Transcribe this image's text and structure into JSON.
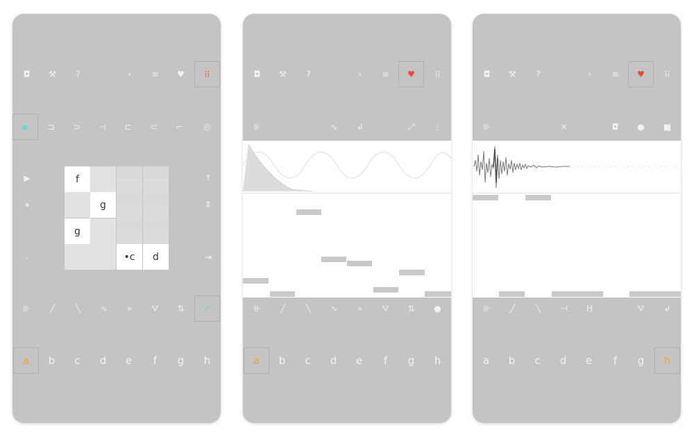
{
  "colors": {
    "phone_bg": "#c4c4c4",
    "icon": "#f2f2f2",
    "accent_orange": "#f0a040",
    "accent_cyan": "#5fd6e8",
    "accent_red": "#e24a3a",
    "note": "#c9c9c9"
  },
  "phones": [
    {
      "top_toolbar": [
        {
          "icon": "square-icon",
          "glyph": "◘",
          "selected": false
        },
        {
          "icon": "wrench-icon",
          "glyph": "⚒",
          "selected": false
        },
        {
          "icon": "help-icon",
          "glyph": "?",
          "selected": false
        },
        {
          "icon": "chevron-right-icon",
          "glyph": "›",
          "selected": false
        },
        {
          "icon": "menu-icon",
          "glyph": "≡",
          "selected": false
        },
        {
          "icon": "heart-icon",
          "glyph": "♥",
          "selected": false
        },
        {
          "icon": "grid-icon",
          "glyph": "⁞⁞",
          "selected": true,
          "accent": "red"
        }
      ],
      "second_toolbar": [
        {
          "icon": "pattern-icon-1",
          "glyph": "▪",
          "selected": true,
          "accent": "cyan"
        },
        {
          "icon": "pattern-icon-2",
          "glyph": "⊐",
          "selected": false
        },
        {
          "icon": "pattern-icon-3",
          "glyph": "⊃",
          "selected": false
        },
        {
          "icon": "pattern-icon-4",
          "glyph": "⊣",
          "selected": false
        },
        {
          "icon": "pattern-icon-5",
          "glyph": "⊏",
          "selected": false
        },
        {
          "icon": "pattern-icon-6",
          "glyph": "⊂",
          "selected": false
        },
        {
          "icon": "pattern-icon-7",
          "glyph": "⌐",
          "selected": false
        },
        {
          "icon": "pattern-icon-8",
          "glyph": "◎",
          "selected": false
        }
      ],
      "grid_labels": [
        "f",
        "g",
        "g",
        "•c",
        "d"
      ],
      "tools": [
        "⊪",
        "╱",
        "╲",
        "∿",
        "»",
        "⛛",
        "⇅",
        "✓"
      ],
      "letters": [
        "a",
        "b",
        "c",
        "d",
        "e",
        "f",
        "g",
        "h"
      ],
      "selected_letter": 0
    },
    {
      "top_toolbar": [
        {
          "icon": "square-icon",
          "glyph": "◘",
          "selected": false
        },
        {
          "icon": "wrench-icon",
          "glyph": "⚒",
          "selected": false
        },
        {
          "icon": "help-icon",
          "glyph": "?",
          "selected": false
        },
        {
          "icon": "chevron-right-icon",
          "glyph": "›",
          "selected": false
        },
        {
          "icon": "menu-icon",
          "glyph": "≡",
          "selected": false
        },
        {
          "icon": "heart-icon",
          "glyph": "♥",
          "selected": true,
          "accent": "red"
        },
        {
          "icon": "grid-icon",
          "glyph": "⁞⁞",
          "selected": false
        }
      ],
      "second_toolbar": [
        "⊪",
        "∿",
        "↲",
        "⤢",
        "⋮"
      ],
      "tools": [
        "⊪",
        "╱",
        "╲",
        "∿",
        "»",
        "⛛",
        "⇅",
        "●"
      ],
      "letters": [
        "a",
        "b",
        "c",
        "d",
        "e",
        "f",
        "g",
        "h"
      ],
      "selected_letter": 0
    },
    {
      "top_toolbar": [
        {
          "icon": "square-icon",
          "glyph": "◘",
          "selected": false
        },
        {
          "icon": "wrench-icon",
          "glyph": "⚒",
          "selected": false
        },
        {
          "icon": "help-icon",
          "glyph": "?",
          "selected": false
        },
        {
          "icon": "chevron-right-icon",
          "glyph": "›",
          "selected": false
        },
        {
          "icon": "menu-icon",
          "glyph": "≡",
          "selected": false
        },
        {
          "icon": "heart-icon",
          "glyph": "♥",
          "selected": true,
          "accent": "red"
        },
        {
          "icon": "grid-icon",
          "glyph": "⁞⁞",
          "selected": false
        }
      ],
      "second_toolbar": [
        "⊪",
        "✕",
        "◘",
        "●",
        "■"
      ],
      "tools": [
        "⊪",
        "╱",
        "╲",
        "⊣",
        "H",
        "⛛",
        "↲"
      ],
      "letters": [
        "a",
        "b",
        "c",
        "d",
        "e",
        "f",
        "g",
        "h"
      ],
      "selected_letter": 7
    }
  ],
  "side_controls_phone1": [
    "▶",
    "⏸",
    "",
    "↑",
    "⇕",
    "⇥"
  ]
}
